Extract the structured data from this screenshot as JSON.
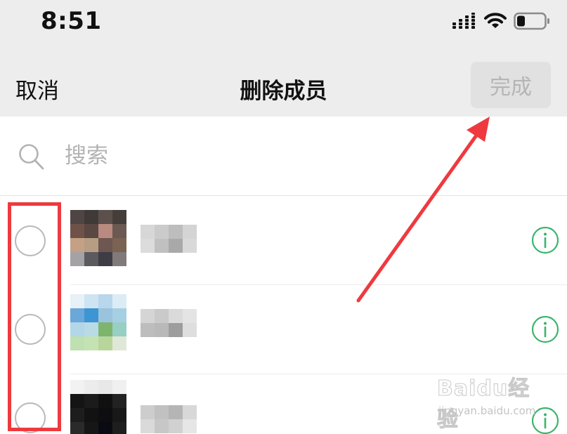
{
  "status_bar": {
    "time": "8:51",
    "icons": [
      "cellular-signal-icon",
      "wifi-icon",
      "battery-icon"
    ],
    "battery_level": 0.3
  },
  "nav": {
    "cancel_label": "取消",
    "title": "删除成员",
    "done_label": "完成",
    "done_enabled": false
  },
  "search": {
    "placeholder": "搜索",
    "value": ""
  },
  "members": [
    {
      "name": "",
      "selected": false
    },
    {
      "name": "",
      "selected": false
    },
    {
      "name": "",
      "selected": false
    }
  ],
  "colors": {
    "header_bg": "#ededed",
    "done_button_bg": "#e1e1e1",
    "done_button_text": "#b5b5b5",
    "info_icon": "#3bb56b",
    "annotation_red": "#ee3a3f"
  },
  "watermark": {
    "main": "Baidu经验",
    "sub": "jingyan.baidu.com"
  }
}
